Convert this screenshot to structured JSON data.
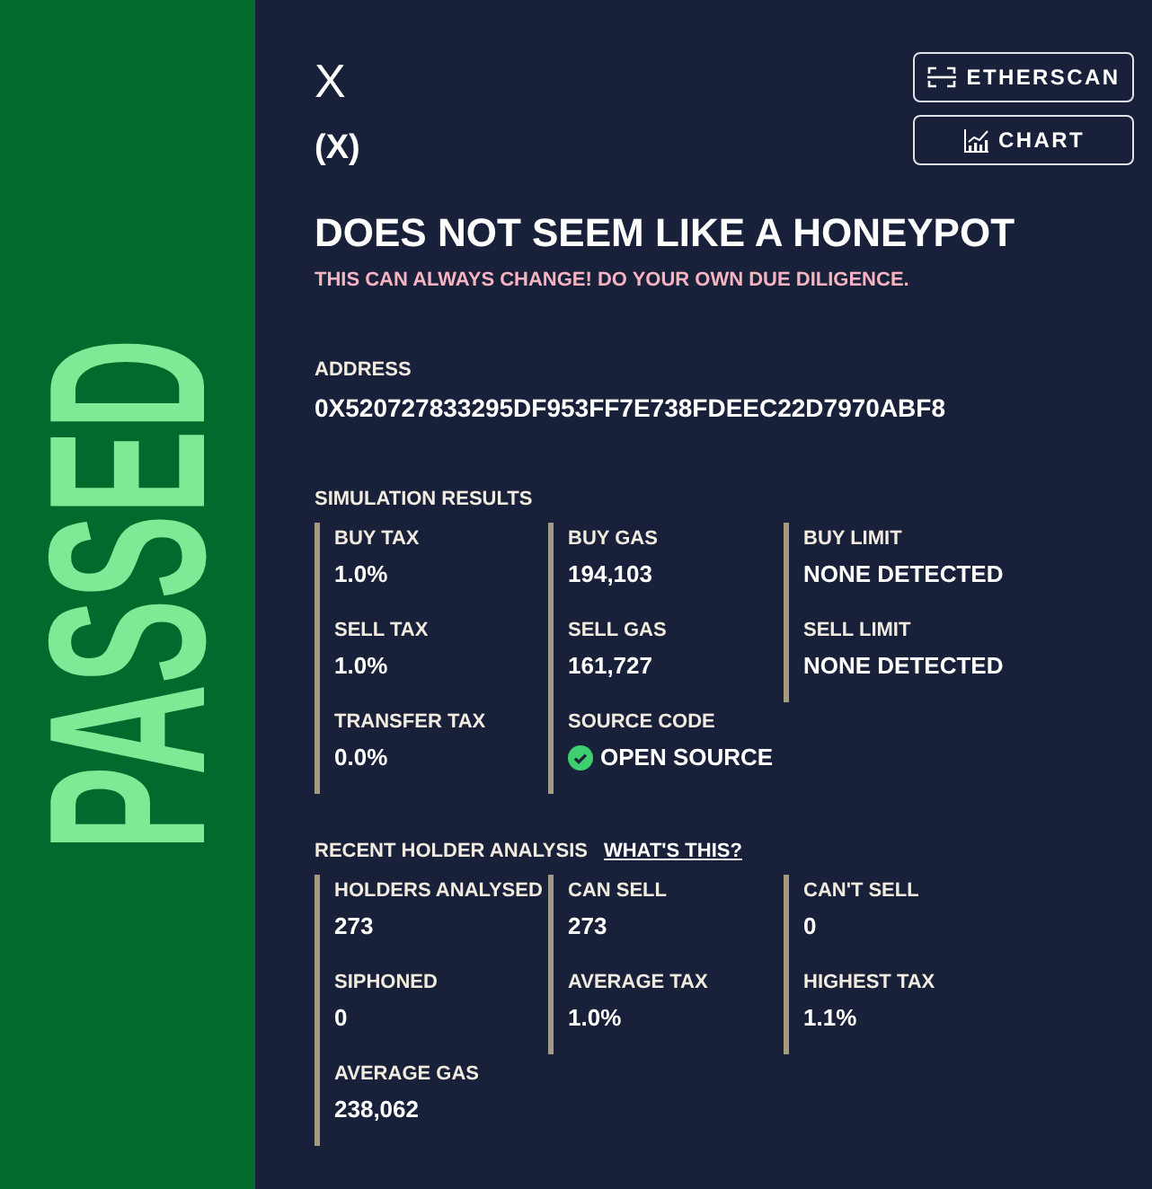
{
  "verdict": {
    "label": "PASSED",
    "kind": "passed"
  },
  "token": {
    "name": "X",
    "symbol": "(X)"
  },
  "buttons": [
    {
      "label": "ETHERSCAN",
      "kind": "scan"
    },
    {
      "label": "CHART",
      "kind": "chart"
    }
  ],
  "result": {
    "title": "DOES NOT SEEM LIKE A HONEYPOT",
    "warning": "THIS CAN ALWAYS CHANGE! DO YOUR OWN DUE DILIGENCE."
  },
  "address": {
    "label": "ADDRESS",
    "value": "0X520727833295DF953FF7E738FDEEC22D7970ABF8"
  },
  "simulation": {
    "title": "SIMULATION RESULTS",
    "columns": [
      {
        "items": [
          {
            "label": "BUY TAX",
            "value": "1.0%"
          },
          {
            "label": "SELL TAX",
            "value": "1.0%"
          },
          {
            "label": "TRANSFER TAX",
            "value": "0.0%"
          }
        ]
      },
      {
        "items": [
          {
            "label": "BUY GAS",
            "value": "194,103"
          },
          {
            "label": "SELL GAS",
            "value": "161,727"
          },
          {
            "label": "SOURCE CODE",
            "value": "OPEN SOURCE",
            "verified": true
          }
        ]
      },
      {
        "items": [
          {
            "label": "BUY LIMIT",
            "value": "NONE DETECTED"
          },
          {
            "label": "SELL LIMIT",
            "value": "NONE DETECTED"
          }
        ]
      }
    ]
  },
  "holder_analysis": {
    "title": "RECENT HOLDER ANALYSIS",
    "link": "WHAT'S THIS?",
    "columns": [
      {
        "items": [
          {
            "label": "HOLDERS ANALYSED",
            "value": "273"
          },
          {
            "label": "SIPHONED",
            "value": "0"
          },
          {
            "label": "AVERAGE GAS",
            "value": "238,062"
          }
        ]
      },
      {
        "items": [
          {
            "label": "CAN SELL",
            "value": "273"
          },
          {
            "label": "AVERAGE TAX",
            "value": "1.0%"
          }
        ]
      },
      {
        "items": [
          {
            "label": "CAN'T SELL",
            "value": "0"
          },
          {
            "label": "HIGHEST TAX",
            "value": "1.1%"
          }
        ]
      }
    ]
  }
}
